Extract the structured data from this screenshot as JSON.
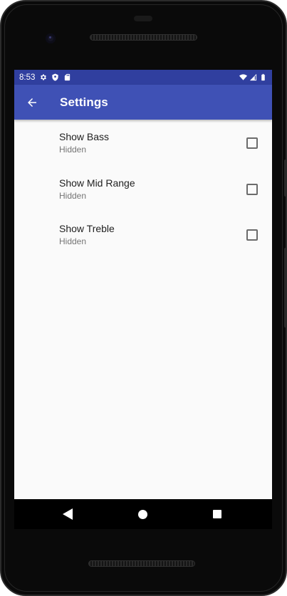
{
  "status_bar": {
    "time": "8:53",
    "left_icons": [
      "settings-icon",
      "shield-icon",
      "sd-card-icon"
    ],
    "right_icons": [
      "wifi-icon",
      "signal-icon",
      "battery-icon"
    ],
    "background": "#303f9f"
  },
  "app_bar": {
    "title": "Settings",
    "back_icon": "arrow-back-icon",
    "background": "#3f51b5"
  },
  "preferences": [
    {
      "title": "Show Bass",
      "summary": "Hidden",
      "checked": false
    },
    {
      "title": "Show Mid Range",
      "summary": "Hidden",
      "checked": false
    },
    {
      "title": "Show Treble",
      "summary": "Hidden",
      "checked": false
    }
  ],
  "nav_bar": {
    "buttons": [
      "nav-back-icon",
      "nav-home-icon",
      "nav-recents-icon"
    ]
  }
}
